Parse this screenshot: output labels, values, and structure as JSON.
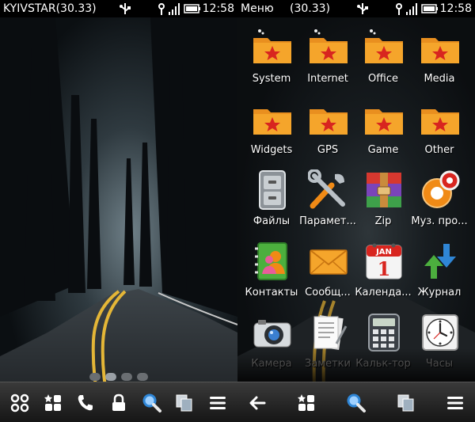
{
  "left_screen": {
    "status": {
      "operator": "KYIVSTAR(30.33)",
      "time": "12:58"
    },
    "page_indicator": {
      "pages": 4,
      "current": 2
    },
    "toolbar": [
      "apps-grid-icon",
      "favorites-icon",
      "phone-icon",
      "lock-icon",
      "search-icon",
      "copy-icon",
      "menu-icon"
    ]
  },
  "right_screen": {
    "status": {
      "title": "Меню",
      "count": "(30.33)",
      "time": "12:58"
    },
    "apps": [
      {
        "label": "System",
        "icon": "folder-icon"
      },
      {
        "label": "Internet",
        "icon": "folder-icon"
      },
      {
        "label": "Office",
        "icon": "folder-icon"
      },
      {
        "label": "Media",
        "icon": "folder-icon"
      },
      {
        "label": "Widgets",
        "icon": "folder-icon"
      },
      {
        "label": "GPS",
        "icon": "folder-icon"
      },
      {
        "label": "Game",
        "icon": "folder-icon"
      },
      {
        "label": "Other",
        "icon": "folder-icon"
      },
      {
        "label": "Файлы",
        "icon": "file-cabinet-icon"
      },
      {
        "label": "Парамет...",
        "icon": "settings-tools-icon"
      },
      {
        "label": "Zip",
        "icon": "zip-archive-icon"
      },
      {
        "label": "Муз. про...",
        "icon": "music-player-icon"
      },
      {
        "label": "Контакты",
        "icon": "contacts-icon"
      },
      {
        "label": "Сообщ...",
        "icon": "messages-icon"
      },
      {
        "label": "Календа...",
        "icon": "calendar-icon"
      },
      {
        "label": "Журнал",
        "icon": "log-icon"
      },
      {
        "label": "Камера",
        "icon": "camera-icon"
      },
      {
        "label": "Заметки",
        "icon": "notes-icon"
      },
      {
        "label": "Кальк-тор",
        "icon": "calculator-icon"
      },
      {
        "label": "Часы",
        "icon": "clock-icon"
      }
    ],
    "calendar": {
      "month": "JAN",
      "day": "1"
    },
    "toolbar": [
      "back-icon",
      "favorites-icon",
      "search-icon",
      "copy-icon",
      "menu-icon"
    ]
  }
}
